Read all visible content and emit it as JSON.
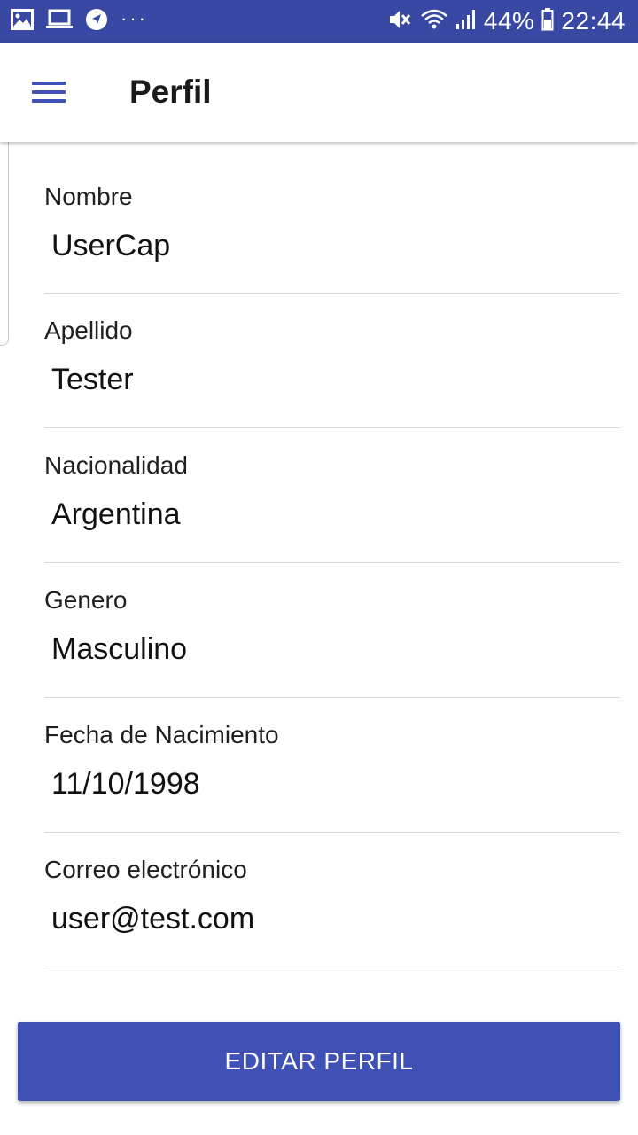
{
  "status_bar": {
    "battery_percent": "44%",
    "time": "22:44",
    "overflow_dots": "···",
    "left_icons": [
      "gallery-icon",
      "laptop-icon",
      "navigation-icon"
    ],
    "right_icons": [
      "mute-icon",
      "wifi-icon",
      "signal-icon",
      "battery-icon"
    ]
  },
  "app_bar": {
    "title": "Perfil",
    "menu_icon": "hamburger-menu-icon"
  },
  "profile": {
    "fields": [
      {
        "label": "Nombre",
        "value": "UserCap"
      },
      {
        "label": "Apellido",
        "value": "Tester"
      },
      {
        "label": "Nacionalidad",
        "value": "Argentina"
      },
      {
        "label": "Genero",
        "value": "Masculino"
      },
      {
        "label": "Fecha de Nacimiento",
        "value": "11/10/1998"
      },
      {
        "label": "Correo electrónico",
        "value": "user@test.com"
      }
    ]
  },
  "actions": {
    "edit_label": "EDITAR PERFIL"
  },
  "colors": {
    "primary": "#3f51b5",
    "status_bar": "#3949a3",
    "divider": "#d9d9d9"
  }
}
